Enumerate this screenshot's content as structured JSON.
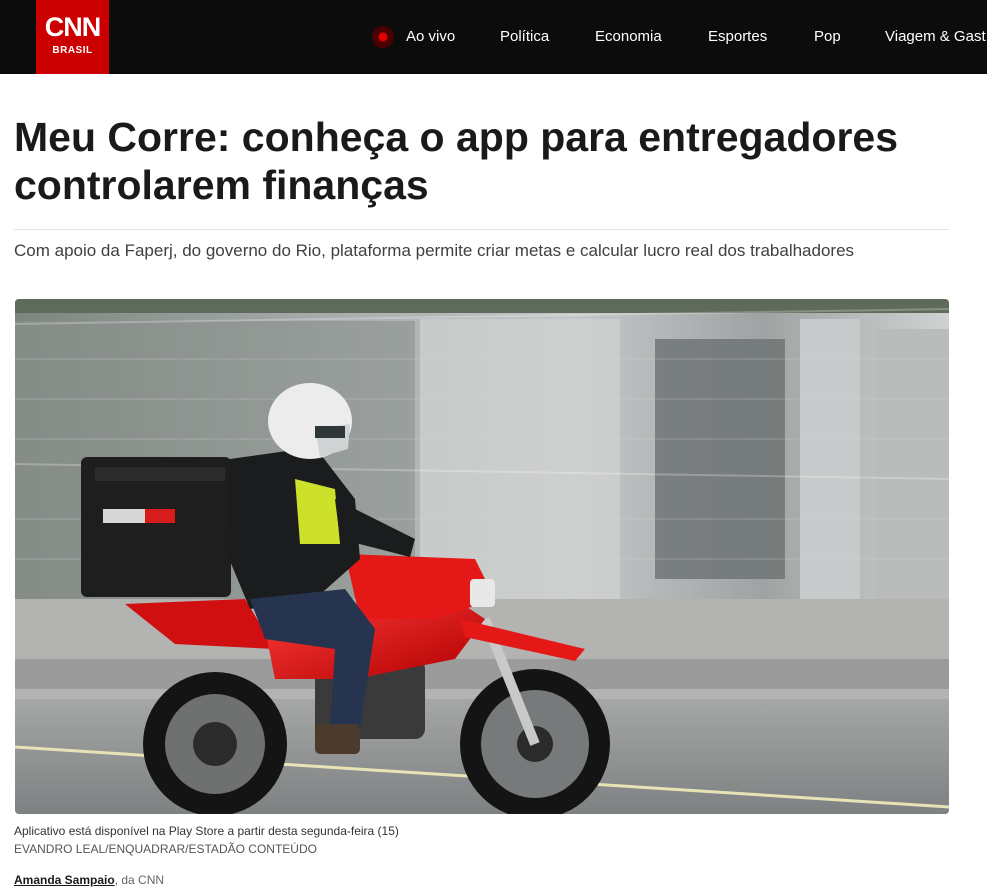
{
  "header": {
    "logo_text": "CNN",
    "logo_subtext": "BRASIL",
    "nav": {
      "live": "Ao vivo",
      "politica": "Política",
      "economia": "Economia",
      "esportes": "Esportes",
      "pop": "Pop",
      "viagem": "Viagem & Gast"
    }
  },
  "article": {
    "headline": "Meu Corre: conheça o app para entregadores controlarem finanças",
    "subtitle": "Com apoio da Faperj, do governo do Rio, plataforma permite criar metas e calcular lucro real dos trabalhadores",
    "image_caption": "Aplicativo está disponível na Play Store a partir desta segunda-feira (15)",
    "image_credit": "EVANDRO LEAL/ENQUADRAR/ESTADÃO CONTEÚDO",
    "author": "Amanda Sampaio",
    "author_suffix": ", da CNN"
  },
  "colors": {
    "brand_red": "#cc0000",
    "topbar": "#0c0c0c",
    "live_dot": "#e00000"
  }
}
